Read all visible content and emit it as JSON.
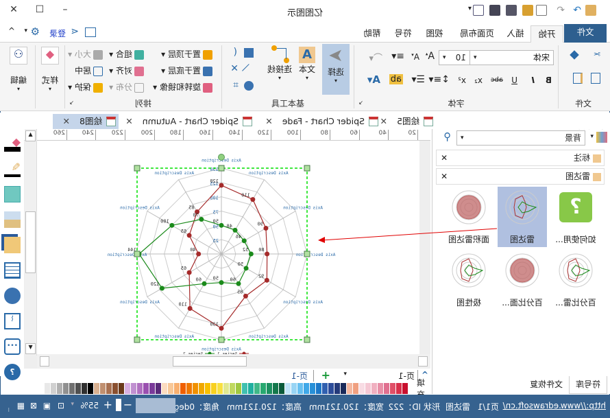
{
  "title": {
    "app_title": "亿图图示"
  },
  "menu": {
    "tabs": [
      "文件",
      "开始",
      "插入",
      "页面布局",
      "视图",
      "符号",
      "帮助"
    ],
    "selected": "开始",
    "login": "登录"
  },
  "ribbon": {
    "file_group": "文件",
    "font_group": "字体",
    "font_name": "宋体",
    "font_size": "10",
    "font_buttons": [
      "B",
      "I",
      "U",
      "abc",
      "x₂",
      "x²"
    ],
    "basic_group": "基本工具",
    "select": "选择",
    "text": "文本",
    "connector": "连接线",
    "arrange_group": "排列",
    "arrange_items": [
      "置于顶层",
      "置于底层",
      "旋转和镜像",
      "组合",
      "对齐",
      "分布",
      "大小",
      "居中",
      "保护"
    ],
    "style": "样式",
    "edit": "编辑"
  },
  "doc_tabs": [
    {
      "label": "绘图5"
    },
    {
      "label": "Spider Chart - Fade"
    },
    {
      "label": "Spider Chart - Autumn"
    },
    {
      "label": "绘图8",
      "selected": true
    }
  ],
  "ruler": {
    "ticks": [
      "20",
      "40",
      "60",
      "80",
      "100",
      "120",
      "140",
      "160",
      "180",
      "200",
      "220",
      "240",
      "260"
    ]
  },
  "library": {
    "title": "符号库",
    "search_value": "背景",
    "sections": [
      "标注",
      "雷达图"
    ],
    "items": [
      "如何使用...",
      "雷达图",
      "面积雷达图",
      "百分比雷...",
      "百分比面...",
      "极性图"
    ],
    "selected": "雷达图"
  },
  "bottom_tabs": [
    "符号库",
    "文件恢复"
  ],
  "pages": {
    "current": "页-1",
    "tab": "页-1"
  },
  "palette_label": "填充",
  "palette": [
    "#c8102e",
    "#d8304a",
    "#e05068",
    "#e07090",
    "#e890a8",
    "#f0b0c0",
    "#f5c8d4",
    "#f8dce4",
    "#f0a080",
    "#f4b8a0",
    "#1a2a5a",
    "#243a7a",
    "#2c4c9a",
    "#3060b0",
    "#1c78c8",
    "#2890d8",
    "#40a8e8",
    "#68c0f0",
    "#98d4f4",
    "#c0e4f8",
    "#0a5a3a",
    "#14784c",
    "#1c9060",
    "#28a870",
    "#40b888",
    "#20b0a0",
    "#40c0b0",
    "#a0c840",
    "#c0d860",
    "#e0e890",
    "#f8e040",
    "#f8d020",
    "#f8c000",
    "#f0a800",
    "#f09000",
    "#f07800",
    "#f06000",
    "#f8b070",
    "#f8c898",
    "#fcdcc0",
    "#5a2a7a",
    "#7a3a9a",
    "#9a50b0",
    "#b070c0",
    "#c090d0",
    "#d8b0e0",
    "#6a3a1a",
    "#8a5030",
    "#a87050",
    "#c09070",
    "#d8b090",
    "#000000",
    "#303030",
    "#505050",
    "#707070",
    "#909090",
    "#b0b0b0",
    "#d0d0d0",
    "#e8e8e8"
  ],
  "status": {
    "url": "http://www.edrawsoft.cn/",
    "page": "页1/1",
    "shape": "雷达图",
    "shape_id": "形状 ID：222",
    "width": "宽度：120.121mm",
    "height": "高度：120.121mm",
    "angle": "角度：0deg",
    "zoom": "55%"
  },
  "chart_data": {
    "type": "radar",
    "axis_labels": [
      "Axis Description",
      "Axis Description",
      "Axis Description",
      "Axis Description",
      "Axis Description",
      "Axis Description",
      "Axis Description",
      "Axis Description",
      "Axis Description",
      "Axis Description",
      "Axis Description",
      "Axis Description"
    ],
    "ring_labels": [
      "25",
      "50",
      "75",
      "100",
      "125",
      "150"
    ],
    "range": [
      0,
      150
    ],
    "series": [
      {
        "name": "Series 1",
        "color": "#a52a2a",
        "values": [
          120,
          85,
          65,
          40,
          65,
          110,
          130,
          85,
          92,
          80,
          90,
          110
        ]
      },
      {
        "name": "Series 2",
        "color": "#1a8a1a",
        "values": [
          50,
          70,
          100,
          144,
          120,
          60,
          50,
          60,
          50,
          52,
          46,
          48
        ]
      }
    ]
  },
  "colors": {
    "accent": "#2e5f8f",
    "status_bar": "#36628f",
    "selection": "#00e000"
  }
}
